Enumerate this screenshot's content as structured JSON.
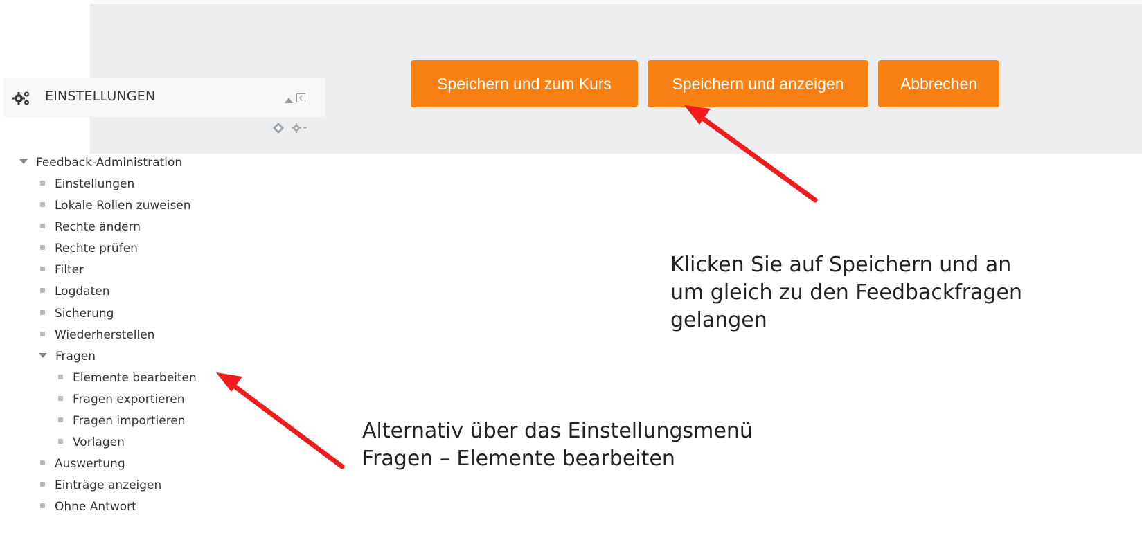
{
  "buttons": {
    "save_course": "Speichern und zum Kurs",
    "save_view": "Speichern und anzeigen",
    "cancel": "Abbrechen"
  },
  "settings": {
    "title": "EINSTELLUNGEN",
    "tree": {
      "root": "Feedback-Administration",
      "items": [
        "Einstellungen",
        "Lokale Rollen zuweisen",
        "Rechte ändern",
        "Rechte prüfen",
        "Filter",
        "Logdaten",
        "Sicherung",
        "Wiederherstellen"
      ],
      "fragen": {
        "label": "Fragen",
        "children": [
          "Elemente bearbeiten",
          "Fragen exportieren",
          "Fragen importieren",
          "Vorlagen"
        ]
      },
      "after": [
        "Auswertung",
        "Einträge anzeigen",
        "Ohne Antwort"
      ]
    }
  },
  "annotations": {
    "top": [
      "Klicken Sie auf Speichern und an",
      "um gleich zu den Feedbackfragen",
      "gelangen"
    ],
    "bottom": [
      "Alternativ über das Einstellungsmenü",
      "Fragen – Elemente bearbeiten"
    ]
  },
  "colors": {
    "button_bg": "#f98012",
    "arrow": "#ee1c1c",
    "bar_bg": "#eceeef"
  },
  "icons": {
    "settings": "gears-icon",
    "collapse": "triangle-up-icon",
    "dock": "dock-icon",
    "edit": "pencil-diamond-icon",
    "gear_menu": "gear-dropdown-icon"
  }
}
